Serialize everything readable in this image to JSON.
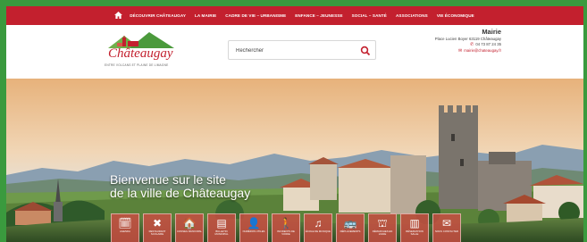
{
  "nav": {
    "items": [
      {
        "label": "DÉCOUVRIR CHÂTEAUGAY"
      },
      {
        "label": "LA MAIRIE"
      },
      {
        "label": "CADRE DE VIE – URBANISME"
      },
      {
        "label": "ENFANCE – JEUNESSE"
      },
      {
        "label": "SOCIAL – SANTÉ"
      },
      {
        "label": "ASSOCIATIONS"
      },
      {
        "label": "VIE ÉCONOMIQUE"
      }
    ]
  },
  "header": {
    "logo_name": "Châteaugay",
    "logo_tagline": "ENTRE VOLCANS ET PLAINE DE LIMAGNE",
    "search_placeholder": "Rechercher",
    "contact": {
      "title": "Mairie",
      "address": "Place Lucien Boyer 63119 Châteaugay",
      "phone": "04 73 87 24 35",
      "email": "mairie@chateaugay.fr"
    }
  },
  "hero": {
    "welcome_line1": "Bienvenue sur le site",
    "welcome_line2": "de la ville de Châteaugay"
  },
  "quick_links": [
    {
      "icon": "🗓",
      "label": "AGENDA"
    },
    {
      "icon": "✖",
      "label": "RESTAURANT SCOLAIRE"
    },
    {
      "icon": "🏠",
      "label": "CONSEIL MUNICIPAL"
    },
    {
      "icon": "▤",
      "label": "BULLETIN MUNICIPAL"
    },
    {
      "icon": "👤",
      "label": "NUMÉROS UTILES"
    },
    {
      "icon": "🚶",
      "label": "INCIDENTS DE VOIRIE"
    },
    {
      "icon": "♫",
      "label": "ÉCOLE DE MUSIQUE"
    },
    {
      "icon": "🚌",
      "label": "DÉPLACEMENTS"
    },
    {
      "icon": "⛫",
      "label": "DÉMARCHES EN LIGNE"
    },
    {
      "icon": "▥",
      "label": "RÉSERVATION SALLE"
    },
    {
      "icon": "✉",
      "label": "NOUS CONTACTER"
    }
  ],
  "colors": {
    "brand_red": "#c3202e",
    "frame_green": "#3a9a3e"
  }
}
